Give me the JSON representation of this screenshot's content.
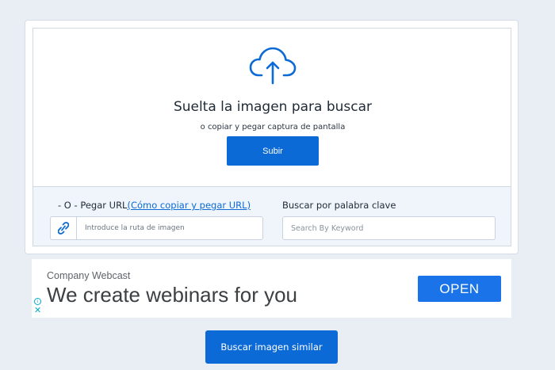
{
  "upload": {
    "icon": "cloud-upload-icon",
    "title": "Suelta la imagen para buscar",
    "subtitle": "o copiar y pegar captura de pantalla",
    "button_label": "Subir"
  },
  "url_section": {
    "label_prefix": "- O - Pegar URL",
    "help_link": "(Cómo copiar y pegar URL)",
    "icon": "link-icon",
    "placeholder": "Introduce la ruta de imagen",
    "value": ""
  },
  "keyword_section": {
    "label": "Buscar por palabra clave",
    "placeholder": "Search By Keyword",
    "value": ""
  },
  "ad": {
    "sponsor": "Company Webcast",
    "headline": "We create webinars for you",
    "cta_label": "OPEN",
    "info_icon": "info-icon",
    "close_icon": "close-icon",
    "info_glyph": "i",
    "close_glyph": "✕"
  },
  "search_button_label": "Buscar imagen similar",
  "colors": {
    "primary": "#0c6ad6",
    "ad_button": "#1a73e8",
    "page_background": "#e9eef5"
  }
}
